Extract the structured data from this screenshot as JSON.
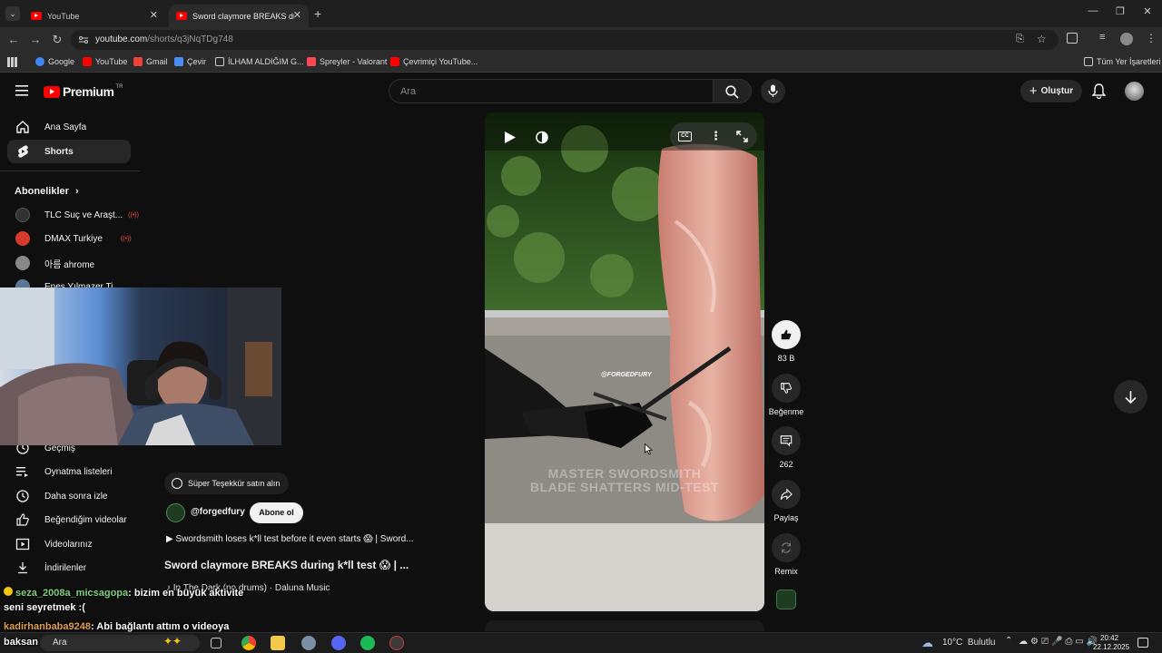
{
  "browser": {
    "tabs": [
      {
        "title": "YouTube",
        "active": false
      },
      {
        "title": "Sword claymore BREAKS during",
        "active": true
      }
    ],
    "url_host": "youtube.com",
    "url_path": "/shorts/q3jNqTDg748",
    "bookmarks": [
      {
        "label": "Google",
        "color": "#4285f4"
      },
      {
        "label": "YouTube",
        "color": "#ff0000"
      },
      {
        "label": "Gmail",
        "color": "#ea4335"
      },
      {
        "label": "Çevir",
        "color": "#4c8bf5"
      },
      {
        "label": "İLHAM ALDIĞIM G...",
        "color": "#e8e8e8"
      },
      {
        "label": "Spreyler - Valorant",
        "color": "#ff4655"
      },
      {
        "label": "Çevrimiçi YouTube...",
        "color": "#ff0000"
      }
    ],
    "all_bookmarks": "Tüm Yer İşaretleri"
  },
  "masthead": {
    "logo_text": "Premium",
    "region": "TR",
    "search_placeholder": "Ara",
    "create_label": "Oluştur"
  },
  "sidebar": {
    "top_items": [
      {
        "label": "Ana Sayfa",
        "icon": "home-icon",
        "active": false
      },
      {
        "label": "Shorts",
        "icon": "shorts-icon",
        "active": true
      }
    ],
    "subs_heading": "Abonelikler",
    "channels": [
      {
        "label": "TLC Suç ve Araşt...",
        "color": "#333333",
        "live": true
      },
      {
        "label": "DMAX Turkiye",
        "color": "#d73a2a",
        "live": true
      },
      {
        "label": "아름 ahrome",
        "color": "#777777",
        "live": false
      },
      {
        "label": "Enes Yılmazer Ti...",
        "color": "#5a7896",
        "live": false
      }
    ],
    "you_items": [
      {
        "label": "Geçmiş",
        "icon": "history-icon"
      },
      {
        "label": "Oynatma listeleri",
        "icon": "playlist-icon"
      },
      {
        "label": "Daha sonra izle",
        "icon": "watch-later-icon"
      },
      {
        "label": "Beğendiğim videolar",
        "icon": "like-icon"
      },
      {
        "label": "Videolarınız",
        "icon": "video-icon"
      },
      {
        "label": "İndirilenler",
        "icon": "download-icon"
      }
    ]
  },
  "short": {
    "overlay_watermark": "@FORGEDFURY",
    "caption_line1": "MASTER SWORDSMITH",
    "caption_line2": "BLADE SHATTERS MID-TEST",
    "super_thanks": "Süper Teşekkür satın alın",
    "channel": "@forgedfury",
    "subscribe": "Abone ol",
    "description": "Swordsmith loses k*ll test before it even starts 😱 | Sword...",
    "title": "Sword claymore BREAKS during k*ll test 😱 | ...",
    "music": "In The Dark (no drums) · Daluna Music"
  },
  "actions": {
    "like_count": "83 B",
    "dislike_label": "Beğenme",
    "comment_count": "262",
    "share_label": "Paylaş",
    "remix_label": "Remix"
  },
  "chat": [
    {
      "user": "seza_2008a_micsagopa",
      "message": ": bizim en büyük aktivite",
      "user_color": "#7fd37f"
    },
    {
      "user": "",
      "message": "seni seyretmek :(",
      "user_color": "#ffffff"
    },
    {
      "user": "kadirhanbaba9248",
      "message": ": Abi bağlantı attım o videoya",
      "user_color": "#e0a050"
    },
    {
      "user": "",
      "message": "baksan",
      "user_color": "#ffffff"
    }
  ],
  "taskbar": {
    "search": "Ara",
    "weather": "10°C  Bulutlu",
    "time": "20:42",
    "date": "22.12.2025"
  }
}
